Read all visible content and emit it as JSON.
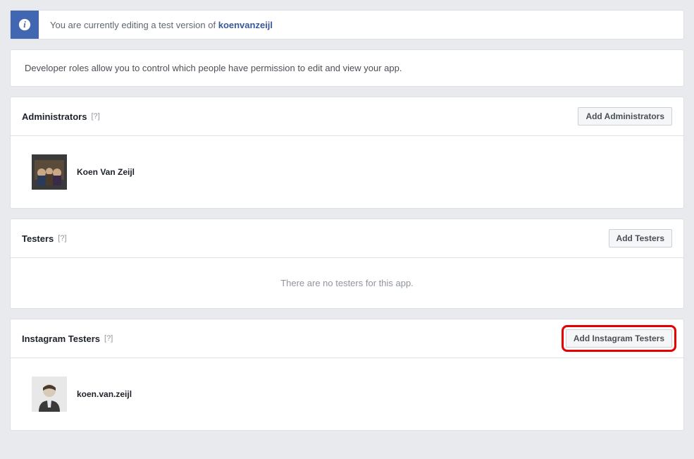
{
  "banner": {
    "text": "You are currently editing a test version of ",
    "link_text": "koenvanzeijl"
  },
  "description": "Developer roles allow you to control which people have permission to edit and view your app.",
  "sections": {
    "administrators": {
      "title": "Administrators",
      "help": "[?]",
      "add_button": "Add Administrators",
      "users": [
        {
          "name": "Koen Van Zeijl"
        }
      ]
    },
    "testers": {
      "title": "Testers",
      "help": "[?]",
      "add_button": "Add Testers",
      "empty": "There are no testers for this app."
    },
    "instagram_testers": {
      "title": "Instagram Testers",
      "help": "[?]",
      "add_button": "Add Instagram Testers",
      "users": [
        {
          "name": "koen.van.zeijl"
        }
      ]
    }
  }
}
